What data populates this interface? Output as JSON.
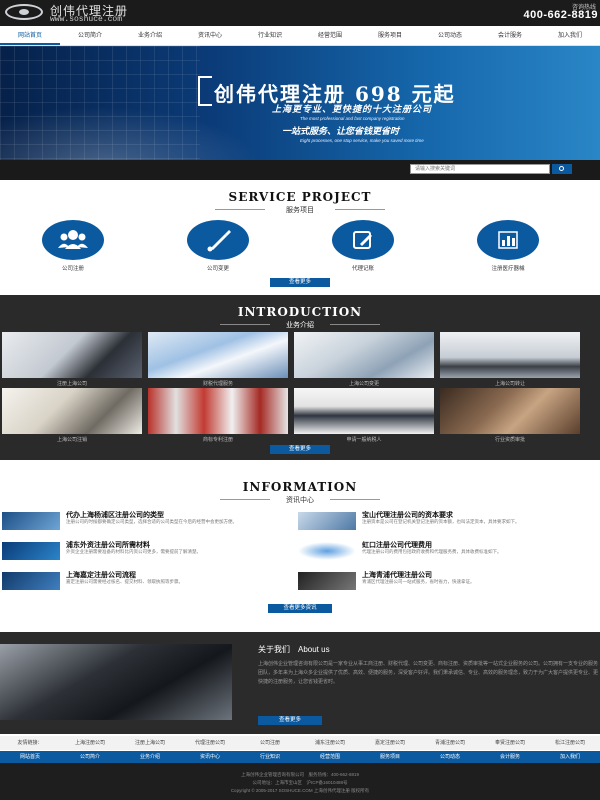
{
  "header": {
    "logo_title": "创伟代理注册",
    "url": "www.soshuce.com",
    "hotline_label": "咨询热线",
    "hotline": "400-662-8819"
  },
  "nav": [
    "网站首页",
    "公司简介",
    "业务介绍",
    "资讯中心",
    "行业知识",
    "经营范围",
    "服务项目",
    "公司动态",
    "会计服务",
    "加入我们"
  ],
  "banner": {
    "title": "创伟代理注册 698 元起",
    "subtitle": "上海更专业、更快捷的十大注册公司",
    "english_1": "The most professional and fast company registration",
    "slogan": "一站式服务、让您省钱更省时",
    "english_2": "Eight processes, one stop service, make you saved more time"
  },
  "search": {
    "placeholder": "请输入搜索关键词"
  },
  "services": {
    "title_en": "SERVICE PROJECT",
    "title_cn": "服务项目",
    "items": [
      {
        "label": "公司注册",
        "icon": "users-icon"
      },
      {
        "label": "公司变更",
        "icon": "brush-icon"
      },
      {
        "label": "代理记账",
        "icon": "edit-icon"
      },
      {
        "label": "注册医疗器械",
        "icon": "bar-chart-icon"
      }
    ],
    "more": "查看更多"
  },
  "intro": {
    "title_en": "INTRODUCTION",
    "title_cn": "业务介绍",
    "photos": [
      "注册上海公司",
      "财税代理服务",
      "上海公司变更",
      "上海公司转让",
      "上海公司注销",
      "商标专利注册",
      "申请一般纳税人",
      "行业资质审批"
    ],
    "more": "查看更多"
  },
  "info": {
    "title_en": "INFORMATION",
    "title_cn": "资讯中心",
    "news": [
      {
        "title": "代办上海杨浦区注册公司的类型",
        "desc": "注册公司的时候都要确定公司类型，选择合适的公司类型在今后的经营中会更加方便。"
      },
      {
        "title": "宝山代理注册公司的资本要求",
        "desc": "注册资本是公司在登记机关登记注册的资本额，也叫法定资本，具体要求如下。"
      },
      {
        "title": "浦东外资注册公司所需材料",
        "desc": "外资企业注册需要准备的材料比内资公司更多，需要提前了解清楚。"
      },
      {
        "title": "虹口注册公司代理费用",
        "desc": "代理注册公司的费用包括政府收费和代理服务费，具体收费标准如下。"
      },
      {
        "title": "上海嘉定注册公司流程",
        "desc": "嘉定注册公司需要经过核名、提交材料、领取执照等步骤。"
      },
      {
        "title": "上海青浦代理注册公司",
        "desc": "青浦区代理注册公司一站式服务，省时省力，快速拿证。"
      }
    ],
    "more": "查看更多资讯"
  },
  "about": {
    "title": "关于我们　About us",
    "text": "上海创伟企业管理咨询有限公司是一家专业从事工商注册、财税代理、公司变更、商标注册、资质审批等一站式企业服务的公司。公司拥有一支专业的服务团队，多年来为上海众多企业提供了优质、高效、便捷的服务，深受客户好评。我们秉承诚信、专业、高效的服务理念，致力于为广大客户提供更专业、更快捷的注册服务，让您省钱更省时。",
    "more": "查看更多"
  },
  "links": [
    "友情链接：",
    "上海注册公司",
    "注册上海公司",
    "代理注册公司",
    "公司注册",
    "浦东注册公司",
    "嘉定注册公司",
    "青浦注册公司",
    "奉贤注册公司",
    "松江注册公司"
  ],
  "footer_nav": [
    "网站首页",
    "公司简介",
    "业务介绍",
    "资讯中心",
    "行业知识",
    "经营范围",
    "服务项目",
    "公司动态",
    "会计服务",
    "加入我们"
  ],
  "footer": {
    "line1": "上海创伟企业管理咨询有限公司　服务热线：400-662-8819",
    "line2": "公司地址：上海市宝山区　沪ICP备16010488号",
    "line3": "Copyright © 2005-2017 SOSHUCE.COM 上海创伟代理注册 版权所有"
  },
  "colors": {
    "brand_blue": "#0b5aa0",
    "dark_bg": "#2a2a2a",
    "top_bar": "#1b1b1b"
  }
}
